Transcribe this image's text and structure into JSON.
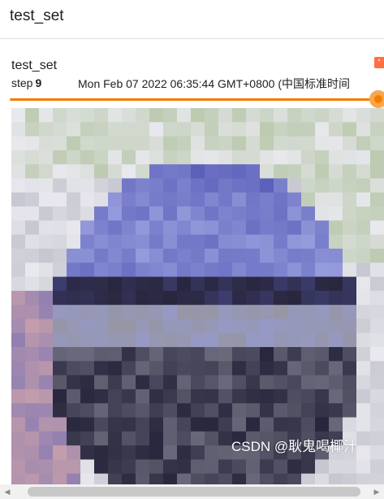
{
  "header": {
    "title": "test_set"
  },
  "card": {
    "run_name": "test_set",
    "step_label": "step",
    "step_value": "9",
    "timestamp": "Mon Feb 07 2022 06:35:44 GMT+0800 (中国标准时间",
    "run_color": "#ff7043",
    "slider": {
      "position_fraction": 1.0,
      "color": "#f57c00"
    },
    "image": {
      "description_icon": "pixelated-car-image"
    }
  },
  "watermark": "CSDN @耿鬼喝椰汁",
  "scrollbar": {
    "left_arrow_icon": "triangle-left-icon",
    "right_arrow_icon": "triangle-right-icon"
  }
}
